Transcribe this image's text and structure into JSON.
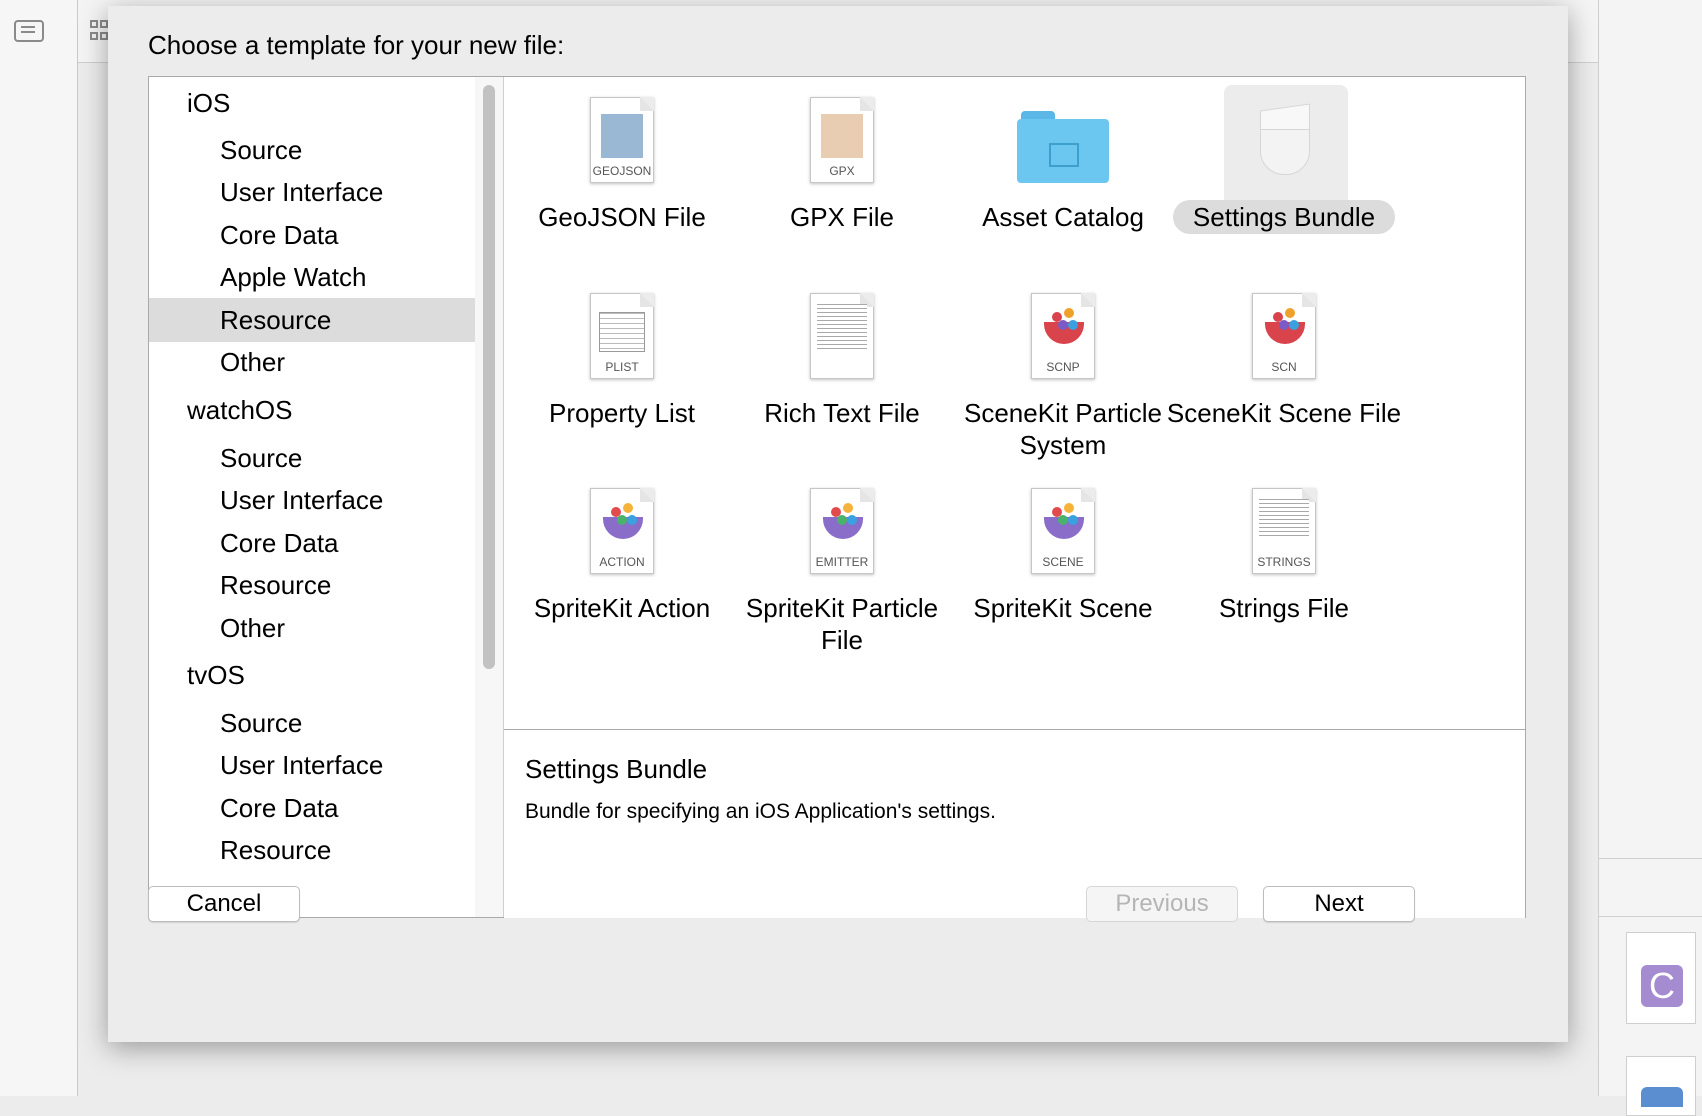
{
  "dialog": {
    "title": "Choose a template for your new file:"
  },
  "sidebar": {
    "items": [
      {
        "label": "iOS",
        "kind": "group"
      },
      {
        "label": "Source",
        "kind": "child"
      },
      {
        "label": "User Interface",
        "kind": "child"
      },
      {
        "label": "Core Data",
        "kind": "child"
      },
      {
        "label": "Apple Watch",
        "kind": "child"
      },
      {
        "label": "Resource",
        "kind": "child",
        "selected": true
      },
      {
        "label": "Other",
        "kind": "child"
      },
      {
        "label": "watchOS",
        "kind": "group"
      },
      {
        "label": "Source",
        "kind": "child"
      },
      {
        "label": "User Interface",
        "kind": "child"
      },
      {
        "label": "Core Data",
        "kind": "child"
      },
      {
        "label": "Resource",
        "kind": "child"
      },
      {
        "label": "Other",
        "kind": "child"
      },
      {
        "label": "tvOS",
        "kind": "group"
      },
      {
        "label": "Source",
        "kind": "child"
      },
      {
        "label": "User Interface",
        "kind": "child"
      },
      {
        "label": "Core Data",
        "kind": "child"
      },
      {
        "label": "Resource",
        "kind": "child"
      }
    ]
  },
  "templates": [
    {
      "label": "GeoJSON File",
      "tag": "GEOJSON",
      "icon": "geojson-file-icon"
    },
    {
      "label": "GPX File",
      "tag": "GPX",
      "icon": "gpx-file-icon"
    },
    {
      "label": "Asset Catalog",
      "tag": "",
      "icon": "folder-icon"
    },
    {
      "label": "Settings Bundle",
      "tag": "",
      "icon": "lego-brick-icon",
      "selected": true
    },
    {
      "label": "Property List",
      "tag": "PLIST",
      "icon": "plist-file-icon"
    },
    {
      "label": "Rich Text File",
      "tag": "",
      "icon": "rich-text-file-icon"
    },
    {
      "label": "SceneKit Particle System",
      "tag": "SCNP",
      "icon": "scenekit-particle-icon"
    },
    {
      "label": "SceneKit Scene File",
      "tag": "SCN",
      "icon": "scenekit-scene-icon"
    },
    {
      "label": "SpriteKit Action",
      "tag": "ACTION",
      "icon": "spritekit-action-icon"
    },
    {
      "label": "SpriteKit Particle File",
      "tag": "EMITTER",
      "icon": "spritekit-emitter-icon"
    },
    {
      "label": "SpriteKit Scene",
      "tag": "SCENE",
      "icon": "spritekit-scene-icon"
    },
    {
      "label": "Strings File",
      "tag": "STRINGS",
      "icon": "strings-file-icon"
    }
  ],
  "description": {
    "title": "Settings Bundle",
    "text": "Bundle for specifying an iOS Application's settings."
  },
  "buttons": {
    "cancel": "Cancel",
    "previous": "Previous",
    "next": "Next"
  },
  "background": {
    "file_letter": "C"
  },
  "colors": {
    "selection": "#dcdcdc",
    "folder": "#6cc7f0",
    "c_file": "#a58bd0"
  }
}
